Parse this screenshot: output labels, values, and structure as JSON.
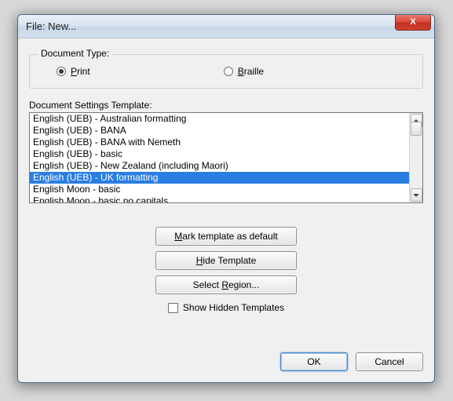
{
  "window": {
    "title": "File: New...",
    "close_glyph": "X"
  },
  "doc_type": {
    "legend": "Document Type:",
    "options": [
      {
        "label_pre": "",
        "mnemonic": "P",
        "label_post": "rint",
        "checked": true
      },
      {
        "label_pre": "",
        "mnemonic": "B",
        "label_post": "raille",
        "checked": false
      }
    ]
  },
  "template_label": "Document Settings Template:",
  "templates": {
    "items": [
      "English (UEB) - Australian formatting",
      "English (UEB) - BANA",
      "English (UEB) - BANA with Nemeth",
      "English (UEB) - basic",
      "English (UEB) - New Zealand (including Maori)",
      "English (UEB) - UK formatting",
      "English Moon - basic",
      "English Moon - basic no capitals"
    ],
    "selected_index": 5
  },
  "buttons": {
    "mark_default": {
      "pre": "",
      "u": "M",
      "post": "ark template as default"
    },
    "hide_template": {
      "pre": "",
      "u": "H",
      "post": "ide Template"
    },
    "select_region": {
      "pre": "Select ",
      "u": "R",
      "post": "egion..."
    }
  },
  "checkbox": {
    "label": "Show Hidden Templates",
    "checked": false
  },
  "dialog": {
    "ok": "OK",
    "cancel": "Cancel"
  }
}
